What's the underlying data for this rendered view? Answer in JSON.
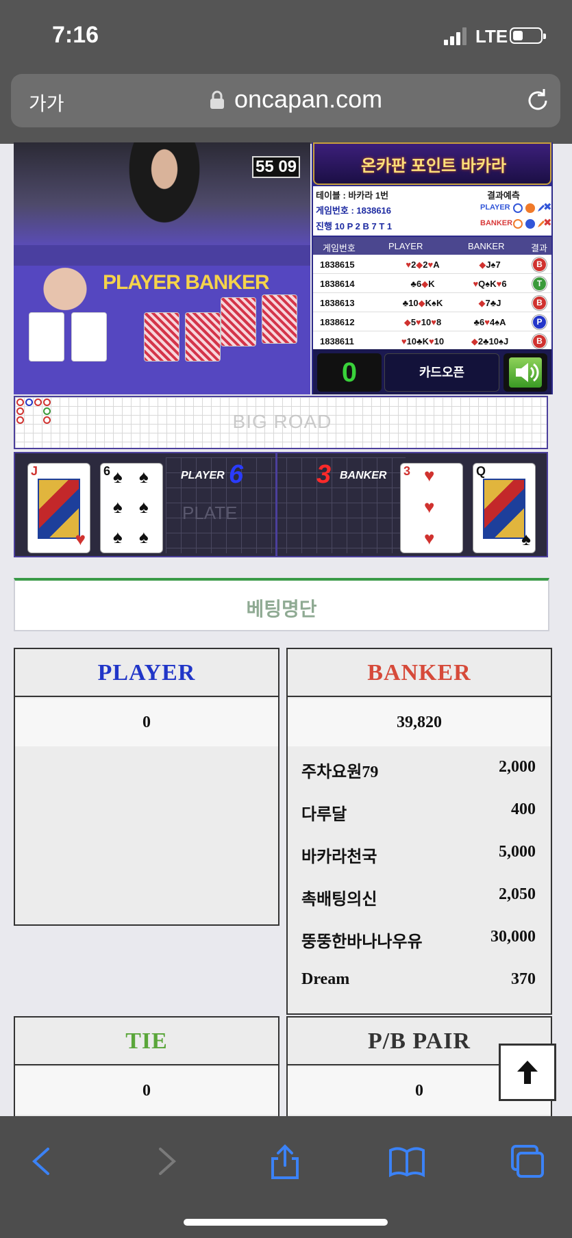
{
  "status_bar": {
    "time": "7:16",
    "network": "LTE"
  },
  "browser": {
    "text_size_label": "가가",
    "domain": "oncapan.com"
  },
  "video": {
    "timer": "55 09",
    "table_text": "PLAYER BANKER"
  },
  "panel": {
    "banner": "온카판 포인트 바카라",
    "table_name": "테이블 : 바카라 1번",
    "game_number": "게임번호 : 1838616",
    "progress": "진행 10   P 2   B 7   T 1",
    "prediction_label": "결과예측",
    "prediction_player": "PLAYER",
    "prediction_banker": "BANKER",
    "headers": {
      "game": "게임번호",
      "player": "PLAYER",
      "banker": "BANKER",
      "result": "결과"
    },
    "rows": [
      {
        "game": "1838615",
        "player": "♥2◆2♥A",
        "banker": "◆J♠7",
        "result": "B",
        "color": "#d0322f"
      },
      {
        "game": "1838614",
        "player": "♣6◆K",
        "banker": "♥Q♠K♥6",
        "result": "T",
        "color": "#3a9a3a"
      },
      {
        "game": "1838613",
        "player": "♣10◆K♠K",
        "banker": "◆7♣J",
        "result": "B",
        "color": "#d0322f"
      },
      {
        "game": "1838612",
        "player": "◆5♥10♥8",
        "banker": "♣6♥4♠A",
        "result": "P",
        "color": "#2336c9"
      },
      {
        "game": "1838611",
        "player": "♥10♣K♥10",
        "banker": "◆2♣10♠J",
        "result": "B",
        "color": "#d0322f"
      }
    ],
    "count": "0",
    "card_open_label": "카드오픈"
  },
  "big_road": {
    "label": "BIG ROAD"
  },
  "card_reveal": {
    "player_label": "PLAYER",
    "player_score": "6",
    "banker_label": "BANKER",
    "banker_score": "3",
    "ghost_text": "PLATE",
    "player_cards": [
      {
        "rank": "J",
        "suit": "♥",
        "color": "#d0322f"
      },
      {
        "rank": "6",
        "suit": "♠",
        "color": "#111111"
      }
    ],
    "banker_cards": [
      {
        "rank": "3",
        "suit": "♥",
        "color": "#d0322f"
      },
      {
        "rank": "Q",
        "suit": "♠",
        "color": "#111111"
      }
    ]
  },
  "betting": {
    "title": "베팅명단",
    "player": {
      "label": "PLAYER",
      "total": "0",
      "color": "#2136c8"
    },
    "banker": {
      "label": "BANKER",
      "total": "39,820",
      "color": "#d64a3a",
      "entries": [
        {
          "name": "주차요원79",
          "amount": "2,000"
        },
        {
          "name": "다루달",
          "amount": "400"
        },
        {
          "name": "바카라천국",
          "amount": "5,000"
        },
        {
          "name": "촉배팅의신",
          "amount": "2,050"
        },
        {
          "name": "뚱뚱한바나나우유",
          "amount": "30,000"
        },
        {
          "name": "Dream",
          "amount": "370"
        }
      ]
    },
    "tie": {
      "label": "TIE",
      "total": "0",
      "color": "#5aa63a"
    },
    "pair": {
      "label": "P/B PAIR",
      "total": "0",
      "color": "#333333"
    }
  },
  "icons": {
    "back": "chevron-left-icon",
    "forward": "chevron-right-icon",
    "share": "share-icon",
    "bookmarks": "book-icon",
    "tabs": "tabs-icon",
    "scroll_top": "arrow-up-icon"
  },
  "colors": {
    "accent_blue": "#3b82f6",
    "toolbar": "#4d4d4d"
  }
}
